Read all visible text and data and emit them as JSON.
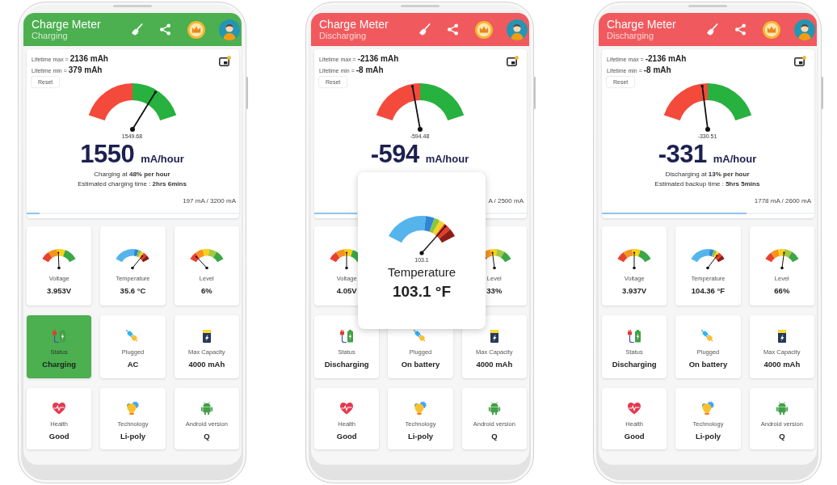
{
  "phones": [
    {
      "color": "#4caf50",
      "app_title": "Charge Meter",
      "status": "Charging",
      "lifetime": [
        {
          "label": "Lifetime max =",
          "value": "2136 mAh"
        },
        {
          "label": "Lifetime min =",
          "value": "379 mAh"
        }
      ],
      "reset_button": "Reset",
      "meter": {
        "level": 0.72,
        "reading": "1549.68"
      },
      "current": {
        "value": "1550",
        "unit": "mA/hour"
      },
      "rate_lines": [
        "Charging at **48% per hour**",
        "Estimated charging time : **2hrs 6mins**"
      ],
      "range": "197 mA / 3200 mA",
      "progress": {
        "level": 0.06
      },
      "cards": [
        {
          "kind": "voltage",
          "label": "Voltage",
          "value": "3.953V",
          "level": 0.48,
          "highlighted": false
        },
        {
          "kind": "temperature",
          "label": "Temperature",
          "value": "35.6 °C",
          "level": 0.82,
          "highlighted": false
        },
        {
          "kind": "level",
          "label": "Level",
          "value": "6%",
          "level": 0.15,
          "highlighted": false
        },
        {
          "kind": "status",
          "label": "Status",
          "value": "Charging",
          "highlighted": true
        },
        {
          "kind": "plugged",
          "label": "Plugged",
          "value": "AC",
          "highlighted": false
        },
        {
          "kind": "capacity",
          "label": "Max Capacity",
          "value": "4000 mAh",
          "highlighted": false
        },
        {
          "kind": "health",
          "label": "Health",
          "value": "Good",
          "highlighted": false
        },
        {
          "kind": "technology",
          "label": "Technology",
          "value": "Li-poly",
          "highlighted": false
        },
        {
          "kind": "android",
          "label": "Android version",
          "value": "Q",
          "highlighted": false
        }
      ]
    },
    {
      "color": "#f05a5e",
      "app_title": "Charge Meter",
      "status": "Discharging",
      "lifetime": [
        {
          "label": "Lifetime max =",
          "value": "-2136 mAh"
        },
        {
          "label": "Lifetime min =",
          "value": "-8 mAh"
        }
      ],
      "reset_button": "Reset",
      "meter": {
        "level": 0.43,
        "reading": "-594.48"
      },
      "current": {
        "value": "-594",
        "unit": "mA/hour"
      },
      "range": "A / 2500 mA",
      "progress": {
        "level": 0.2
      },
      "cards": [
        {
          "kind": "voltage",
          "label": "Voltage",
          "value": "4.05V",
          "level": 0.5,
          "highlighted": false
        },
        {
          "kind": "covered"
        },
        {
          "kind": "level",
          "label": "Level",
          "value": "33%",
          "level": 0.44,
          "highlighted": false
        },
        {
          "kind": "status",
          "label": "Status",
          "value": "Discharging",
          "highlighted": false
        },
        {
          "kind": "plugged",
          "label": "Plugged",
          "value": "On battery",
          "highlighted": false
        },
        {
          "kind": "capacity",
          "label": "Max Capacity",
          "value": "4000 mAh",
          "highlighted": false
        },
        {
          "kind": "health",
          "label": "Health",
          "value": "Good",
          "highlighted": false
        },
        {
          "kind": "technology",
          "label": "Technology",
          "value": "Li-poly",
          "highlighted": false
        },
        {
          "kind": "android",
          "label": "Android version",
          "value": "Q",
          "highlighted": false
        }
      ],
      "popup": {
        "kind": "temperature",
        "level": 0.83,
        "reading": "103.1",
        "label": "Temperature",
        "value": "103.1 °F"
      }
    },
    {
      "color": "#f05a5e",
      "app_title": "Charge Meter",
      "status": "Discharging",
      "lifetime": [
        {
          "label": "Lifetime max =",
          "value": "-2136 mAh"
        },
        {
          "label": "Lifetime min =",
          "value": "-8 mAh"
        }
      ],
      "reset_button": "Reset",
      "meter": {
        "level": 0.45,
        "reading": "-330.51"
      },
      "current": {
        "value": "-331",
        "unit": "mA/hour"
      },
      "rate_lines": [
        "Discharging at **13% per hour**",
        "Estimated backup time : **5hrs 5mins**"
      ],
      "range": "1778 mA / 2600 mA",
      "progress": {
        "level": 0.68
      },
      "cards": [
        {
          "kind": "voltage",
          "label": "Voltage",
          "value": "3.937V",
          "level": 0.5,
          "highlighted": false
        },
        {
          "kind": "temperature",
          "label": "Temperature",
          "value": "104.36 °F",
          "level": 0.8,
          "highlighted": false
        },
        {
          "kind": "level",
          "label": "Level",
          "value": "66%",
          "level": 0.56,
          "highlighted": false
        },
        {
          "kind": "status",
          "label": "Status",
          "value": "Discharging",
          "highlighted": false
        },
        {
          "kind": "plugged",
          "label": "Plugged",
          "value": "On battery",
          "highlighted": false
        },
        {
          "kind": "capacity",
          "label": "Max Capacity",
          "value": "4000 mAh",
          "highlighted": false
        },
        {
          "kind": "health",
          "label": "Health",
          "value": "Good",
          "highlighted": false
        },
        {
          "kind": "technology",
          "label": "Technology",
          "value": "Li-poly",
          "highlighted": false
        },
        {
          "kind": "android",
          "label": "Android version",
          "value": "Q",
          "highlighted": false
        }
      ]
    }
  ]
}
